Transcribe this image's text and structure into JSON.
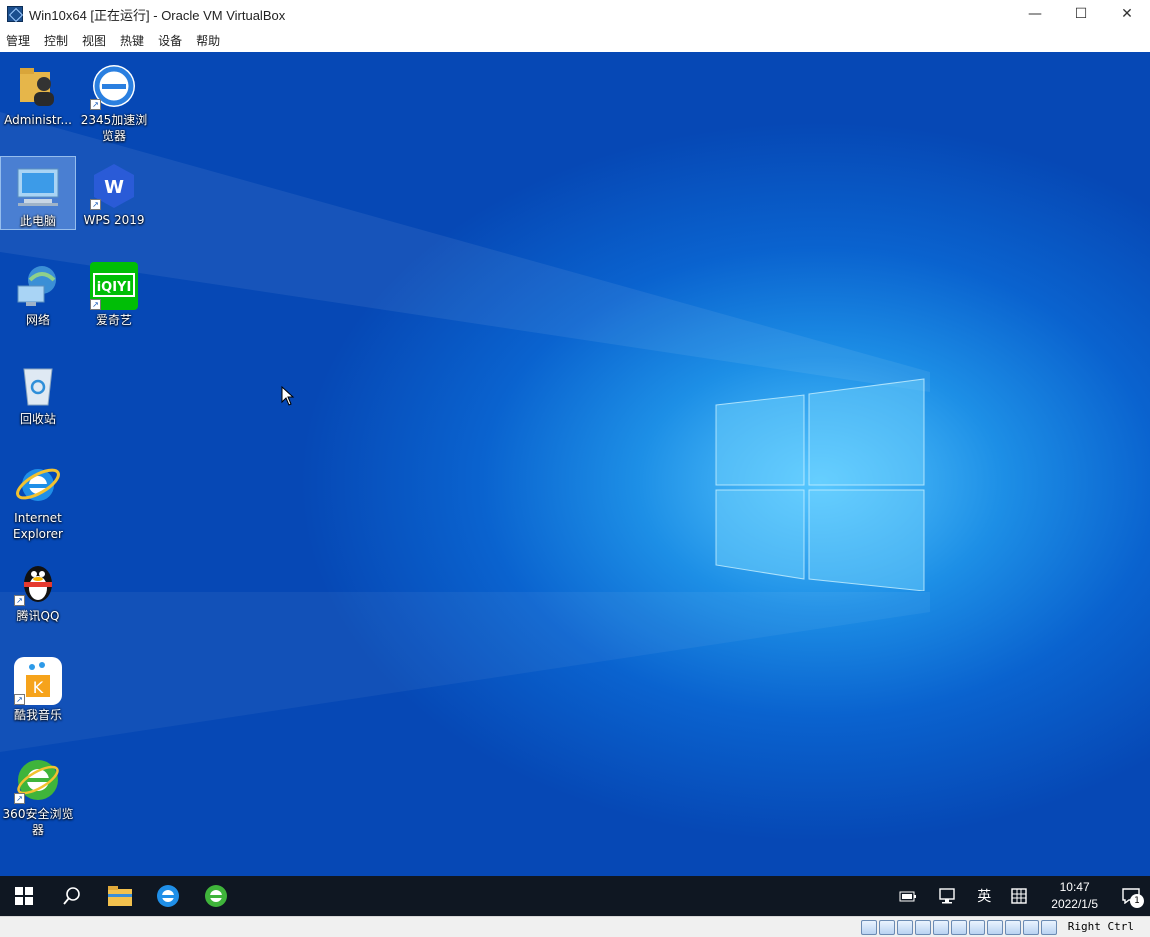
{
  "window": {
    "title": "Win10x64 [正在运行] - Oracle VM VirtualBox",
    "controls": {
      "minimize": "—",
      "maximize": "☐",
      "close": "✕"
    }
  },
  "menu": [
    "管理",
    "控制",
    "视图",
    "热键",
    "设备",
    "帮助"
  ],
  "desktop_icons": [
    {
      "label": "Administr...",
      "icon": "user-folder-icon"
    },
    {
      "label": "2345加速浏览器",
      "icon": "2345-browser-icon"
    },
    {
      "label": "此电脑",
      "icon": "this-pc-icon",
      "selected": true
    },
    {
      "label": "WPS 2019",
      "icon": "wps-icon"
    },
    {
      "label": "网络",
      "icon": "network-icon"
    },
    {
      "label": "爱奇艺",
      "icon": "iqiyi-icon"
    },
    {
      "label": "回收站",
      "icon": "recycle-bin-icon"
    },
    {
      "label": "Internet Explorer",
      "icon": "ie-icon"
    },
    {
      "label": "腾讯QQ",
      "icon": "qq-icon"
    },
    {
      "label": "酷我音乐",
      "icon": "kuwo-icon"
    },
    {
      "label": "360安全浏览器",
      "icon": "360-browser-icon"
    }
  ],
  "iqiyi_logo": "iQIYI",
  "wps_logo": "W",
  "taskbar": {
    "tray": {
      "ime": "英",
      "time": "10:47",
      "date": "2022/1/5",
      "notifications": "1"
    }
  },
  "statusbar": {
    "host_key": "Right Ctrl"
  },
  "colors": {
    "desktop_blue": "#0a63cf",
    "taskbar": "#0f1722",
    "iqiyi_green": "#00be06"
  }
}
